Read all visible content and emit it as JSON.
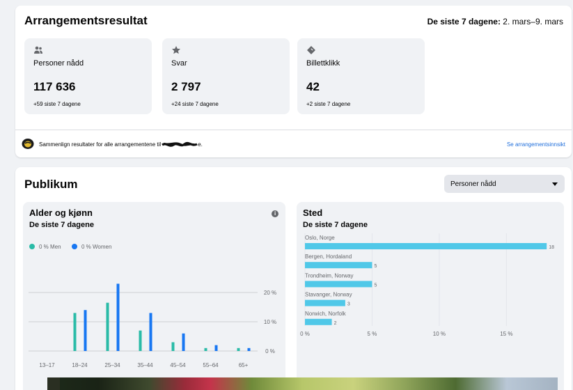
{
  "results": {
    "title": "Arrangementsresultat",
    "period_label": "De siste 7 dagene:",
    "period_range": "2. mars–9. mars",
    "metrics": [
      {
        "icon": "people-icon",
        "label": "Personer nådd",
        "value": "117 636",
        "change": "+59 siste 7 dagene"
      },
      {
        "icon": "star-icon",
        "label": "Svar",
        "value": "2 797",
        "change": "+24 siste 7 dagene"
      },
      {
        "icon": "ticket-icon",
        "label": "Billettklikk",
        "value": "42",
        "change": "+2 siste 7 dagene"
      }
    ],
    "compare_text": "Sammenlign resultater for alle arrangementene til",
    "compare_suffix": "e.",
    "insights_link": "Se arrangementsinnsikt"
  },
  "audience": {
    "title": "Publikum",
    "dropdown_value": "Personer nådd",
    "age_panel": {
      "title": "Alder og kjønn",
      "subtitle": "De siste 7 dagene",
      "legend_men": "0 % Men",
      "legend_women": "0 % Women"
    },
    "location_panel": {
      "title": "Sted",
      "subtitle": "De siste 7 dagene"
    }
  },
  "colors": {
    "men": "#2abba7",
    "women": "#1877f2",
    "location_bar": "#50c8e8",
    "link": "#216fdb"
  },
  "chart_data": [
    {
      "type": "bar",
      "categories": [
        "13–17",
        "18–24",
        "25–34",
        "35–44",
        "45–54",
        "55–64",
        "65+"
      ],
      "series": [
        {
          "name": "0 % Men",
          "values": [
            0,
            13,
            16.5,
            7,
            3,
            1,
            1
          ]
        },
        {
          "name": "0 % Women",
          "values": [
            0,
            14,
            23,
            13,
            6,
            2,
            1
          ]
        }
      ],
      "y_ticks": [
        "20 %",
        "10 %",
        "0 %"
      ],
      "ylim": [
        0,
        25
      ]
    },
    {
      "type": "bar",
      "orientation": "horizontal",
      "categories": [
        "Oslo, Norge",
        "Bergen, Hordaland",
        "Trondheim, Norway",
        "Stavanger, Norway",
        "Norwich, Norfolk"
      ],
      "values": [
        18,
        5,
        5,
        3,
        2
      ],
      "x_ticks": [
        "0 %",
        "5 %",
        "10 %",
        "15 %"
      ],
      "xlim": [
        0,
        18.3
      ]
    }
  ]
}
